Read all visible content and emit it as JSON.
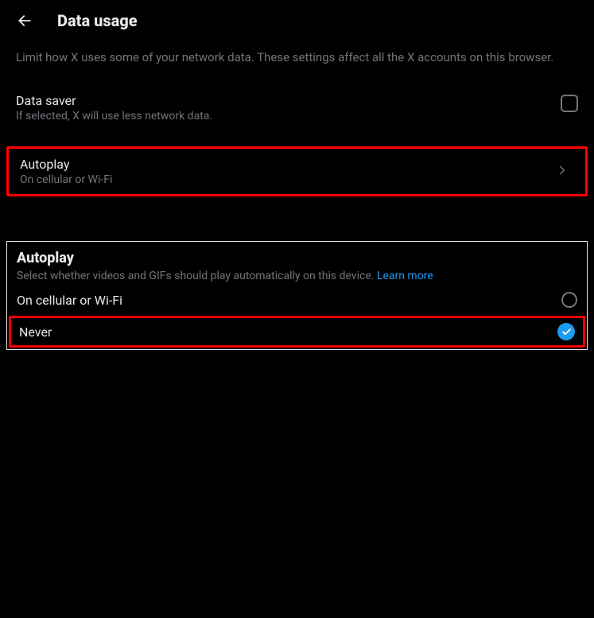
{
  "header": {
    "title": "Data usage"
  },
  "description": "Limit how X uses some of your network data. These settings affect all the X accounts on this browser.",
  "dataSaver": {
    "title": "Data saver",
    "subtitle": "If selected, X will use less network data.",
    "checked": false
  },
  "autoplayNav": {
    "title": "Autoplay",
    "subtitle": "On cellular or Wi-Fi"
  },
  "autoplayPanel": {
    "title": "Autoplay",
    "description": "Select whether videos and GIFs should play automatically on this device. ",
    "learnMore": "Learn more",
    "options": [
      {
        "label": "On cellular or Wi-Fi",
        "selected": false
      },
      {
        "label": "Never",
        "selected": true
      }
    ]
  }
}
